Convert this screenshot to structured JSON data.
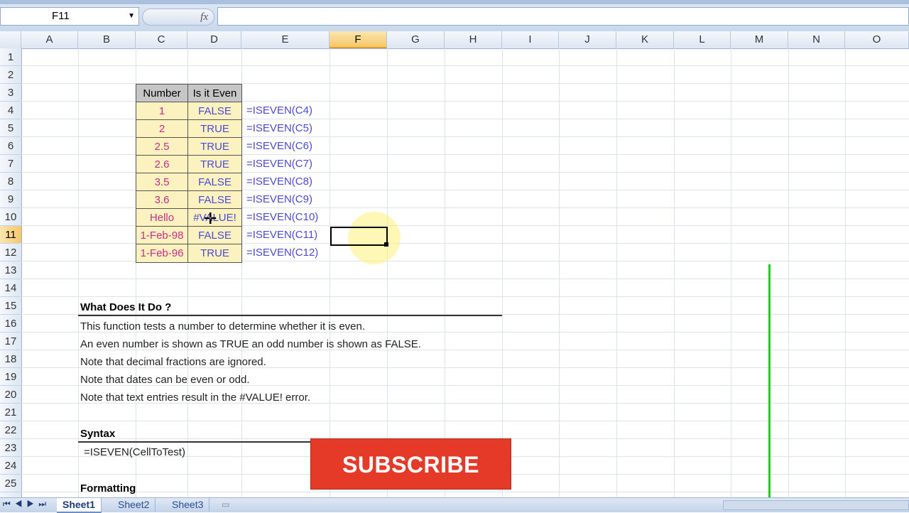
{
  "formula_bar": {
    "name_box": "F11",
    "fx_label": "fx",
    "formula_value": ""
  },
  "columns": [
    "A",
    "B",
    "C",
    "D",
    "E",
    "F",
    "G",
    "H",
    "I",
    "J",
    "K",
    "L",
    "M",
    "N",
    "O"
  ],
  "rows": [
    "1",
    "2",
    "3",
    "4",
    "5",
    "6",
    "7",
    "8",
    "9",
    "10",
    "11",
    "12",
    "13",
    "14",
    "15",
    "16",
    "17",
    "18",
    "19",
    "20",
    "21",
    "22",
    "23",
    "24",
    "25"
  ],
  "table": {
    "header_number": "Number",
    "header_even": "Is it Even",
    "rows": [
      {
        "number": "1",
        "even": "FALSE",
        "formula": "=ISEVEN(C4)"
      },
      {
        "number": "2",
        "even": "TRUE",
        "formula": "=ISEVEN(C5)"
      },
      {
        "number": "2.5",
        "even": "TRUE",
        "formula": "=ISEVEN(C6)"
      },
      {
        "number": "2.6",
        "even": "TRUE",
        "formula": "=ISEVEN(C7)"
      },
      {
        "number": "3.5",
        "even": "FALSE",
        "formula": "=ISEVEN(C8)"
      },
      {
        "number": "3.6",
        "even": "FALSE",
        "formula": "=ISEVEN(C9)"
      },
      {
        "number": "Hello",
        "even": "#VALUE!",
        "formula": "=ISEVEN(C10)"
      },
      {
        "number": "1-Feb-98",
        "even": "FALSE",
        "formula": "=ISEVEN(C11)"
      },
      {
        "number": "1-Feb-96",
        "even": "TRUE",
        "formula": "=ISEVEN(C12)"
      }
    ]
  },
  "what_section": {
    "title": "What Does It Do ?",
    "lines": [
      "This function tests a number to determine whether it is even.",
      "An even number is shown as TRUE an odd number is shown as FALSE.",
      "Note that decimal fractions are ignored.",
      "Note that dates can be even or odd.",
      "Note that text entries result in the #VALUE! error."
    ]
  },
  "syntax_section": {
    "title": "Syntax",
    "text": "=ISEVEN(CellToTest)"
  },
  "formatting_section": {
    "title": "Formatting"
  },
  "subscribe_label": "SUBSCRIBE",
  "sheets": [
    "Sheet1",
    "Sheet2",
    "Sheet3"
  ],
  "active_sheet": "Sheet1",
  "colors": {
    "accent_red": "#e53a27",
    "green_line": "#22cc22",
    "selection_orange": "#f6c768"
  }
}
